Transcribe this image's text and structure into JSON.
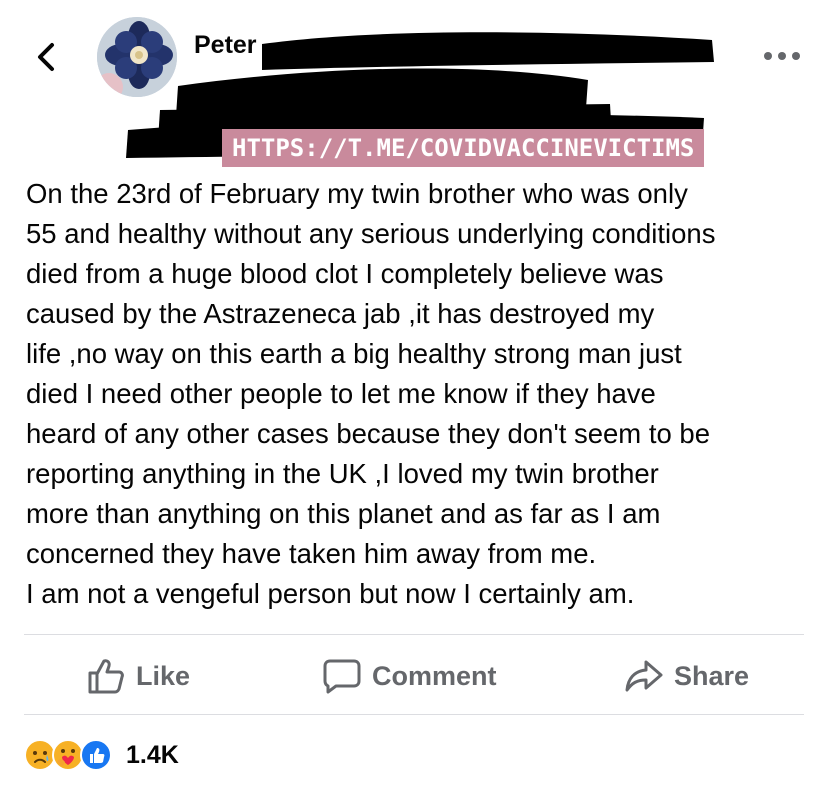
{
  "post": {
    "author_name_visible": "Peter",
    "watermark": "HTTPS://T.ME/COVIDVACCINEVICTIMS",
    "body": "On the 23rd of February my twin brother who was only\n55 and healthy without any serious underlying conditions\ndied from a huge blood clot I completely believe was\ncaused by the Astrazeneca jab ,it has destroyed my\nlife ,no way on this earth a big healthy strong man just\ndied I need other people to let me know if they have\nheard of any other cases because they don't seem to be\nreporting anything in the UK ,I loved my twin brother\nmore than anything on this planet and as far as I am\nconcerned they have taken him away from me.\nI am not a vengeful person but now I certainly am."
  },
  "actions": {
    "like": "Like",
    "comment": "Comment",
    "share": "Share"
  },
  "reactions": {
    "icons": [
      "sad-reaction-icon",
      "care-reaction-icon",
      "like-reaction-icon"
    ],
    "count": "1.4K"
  },
  "colors": {
    "text": "#050505",
    "secondary": "#65676b",
    "divider": "#dcdde1",
    "watermark_bg": "#c98a9c",
    "like_blue": "#1877f2",
    "reaction_yellow": "#f7b125"
  }
}
